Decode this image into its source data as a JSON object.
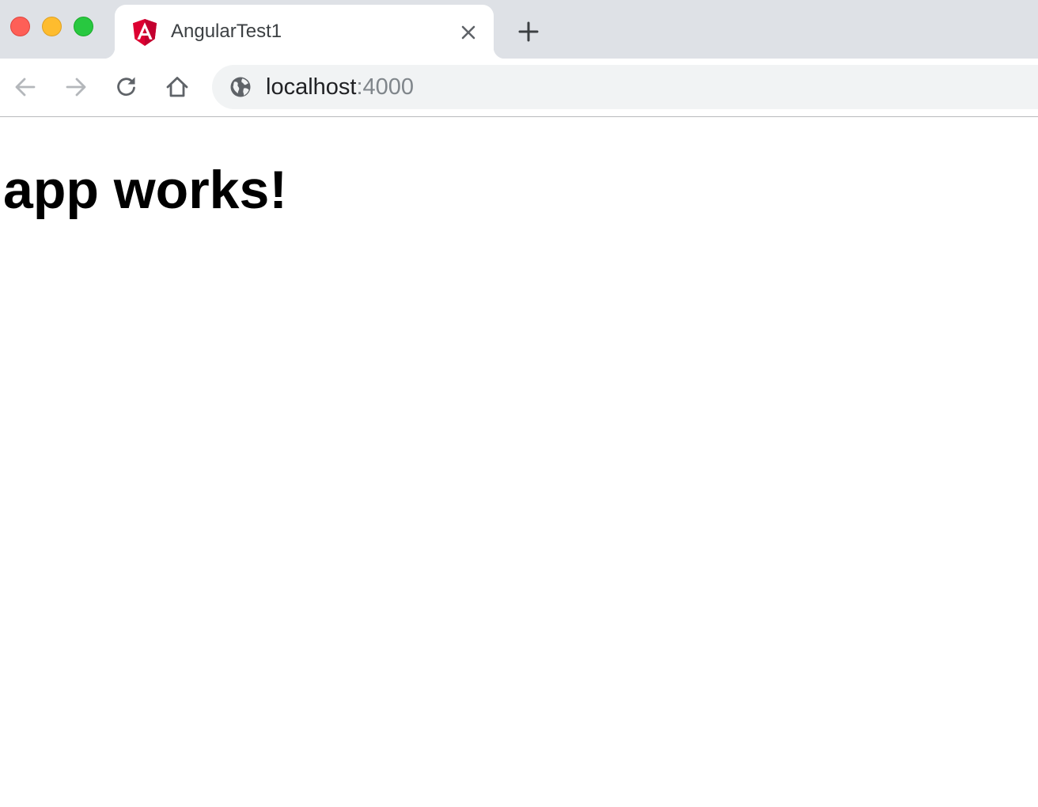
{
  "window": {
    "traffic_lights": {
      "close_color": "#fe5f57",
      "minimize_color": "#febc2e",
      "maximize_color": "#28c840"
    }
  },
  "tab": {
    "title": "AngularTest1",
    "favicon": "angular-logo-icon",
    "favicon_color": "#dd0031",
    "close_icon": "close-icon"
  },
  "new_tab": {
    "icon": "plus-icon"
  },
  "toolbar": {
    "back_icon": "arrow-left-icon",
    "forward_icon": "arrow-right-icon",
    "reload_icon": "reload-icon",
    "home_icon": "home-icon"
  },
  "address_bar": {
    "site_icon": "globe-icon",
    "host": "localhost",
    "port": ":4000"
  },
  "page": {
    "heading": "app works!"
  }
}
